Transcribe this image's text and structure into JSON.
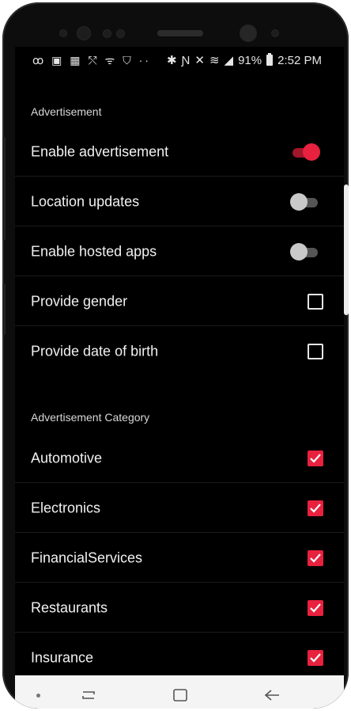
{
  "status_bar": {
    "left_icons": [
      "voicemail-icon",
      "photo-icon",
      "image-icon",
      "missed-call-icon",
      "wifi-call-icon",
      "shield-icon",
      "more-dots-icon"
    ],
    "battery_percent": "91%",
    "time": "2:52 PM"
  },
  "sections": {
    "advertisement": {
      "title": "Advertisement"
    },
    "category": {
      "title": "Advertisement Category"
    }
  },
  "settings": [
    {
      "label": "Enable advertisement",
      "control": "toggle",
      "checked": true
    },
    {
      "label": "Location updates",
      "control": "toggle",
      "checked": false
    },
    {
      "label": "Enable hosted apps",
      "control": "toggle",
      "checked": false
    },
    {
      "label": "Provide gender",
      "control": "checkbox",
      "checked": false
    },
    {
      "label": "Provide date of birth",
      "control": "checkbox",
      "checked": false
    }
  ],
  "categories": [
    {
      "label": "Automotive",
      "checked": true
    },
    {
      "label": "Electronics",
      "checked": true
    },
    {
      "label": "FinancialServices",
      "checked": true
    },
    {
      "label": "Restaurants",
      "checked": true
    },
    {
      "label": "Insurance",
      "checked": true
    }
  ],
  "colors": {
    "accent": "#e8213f",
    "background": "#000000",
    "text": "#f1f1f1"
  }
}
